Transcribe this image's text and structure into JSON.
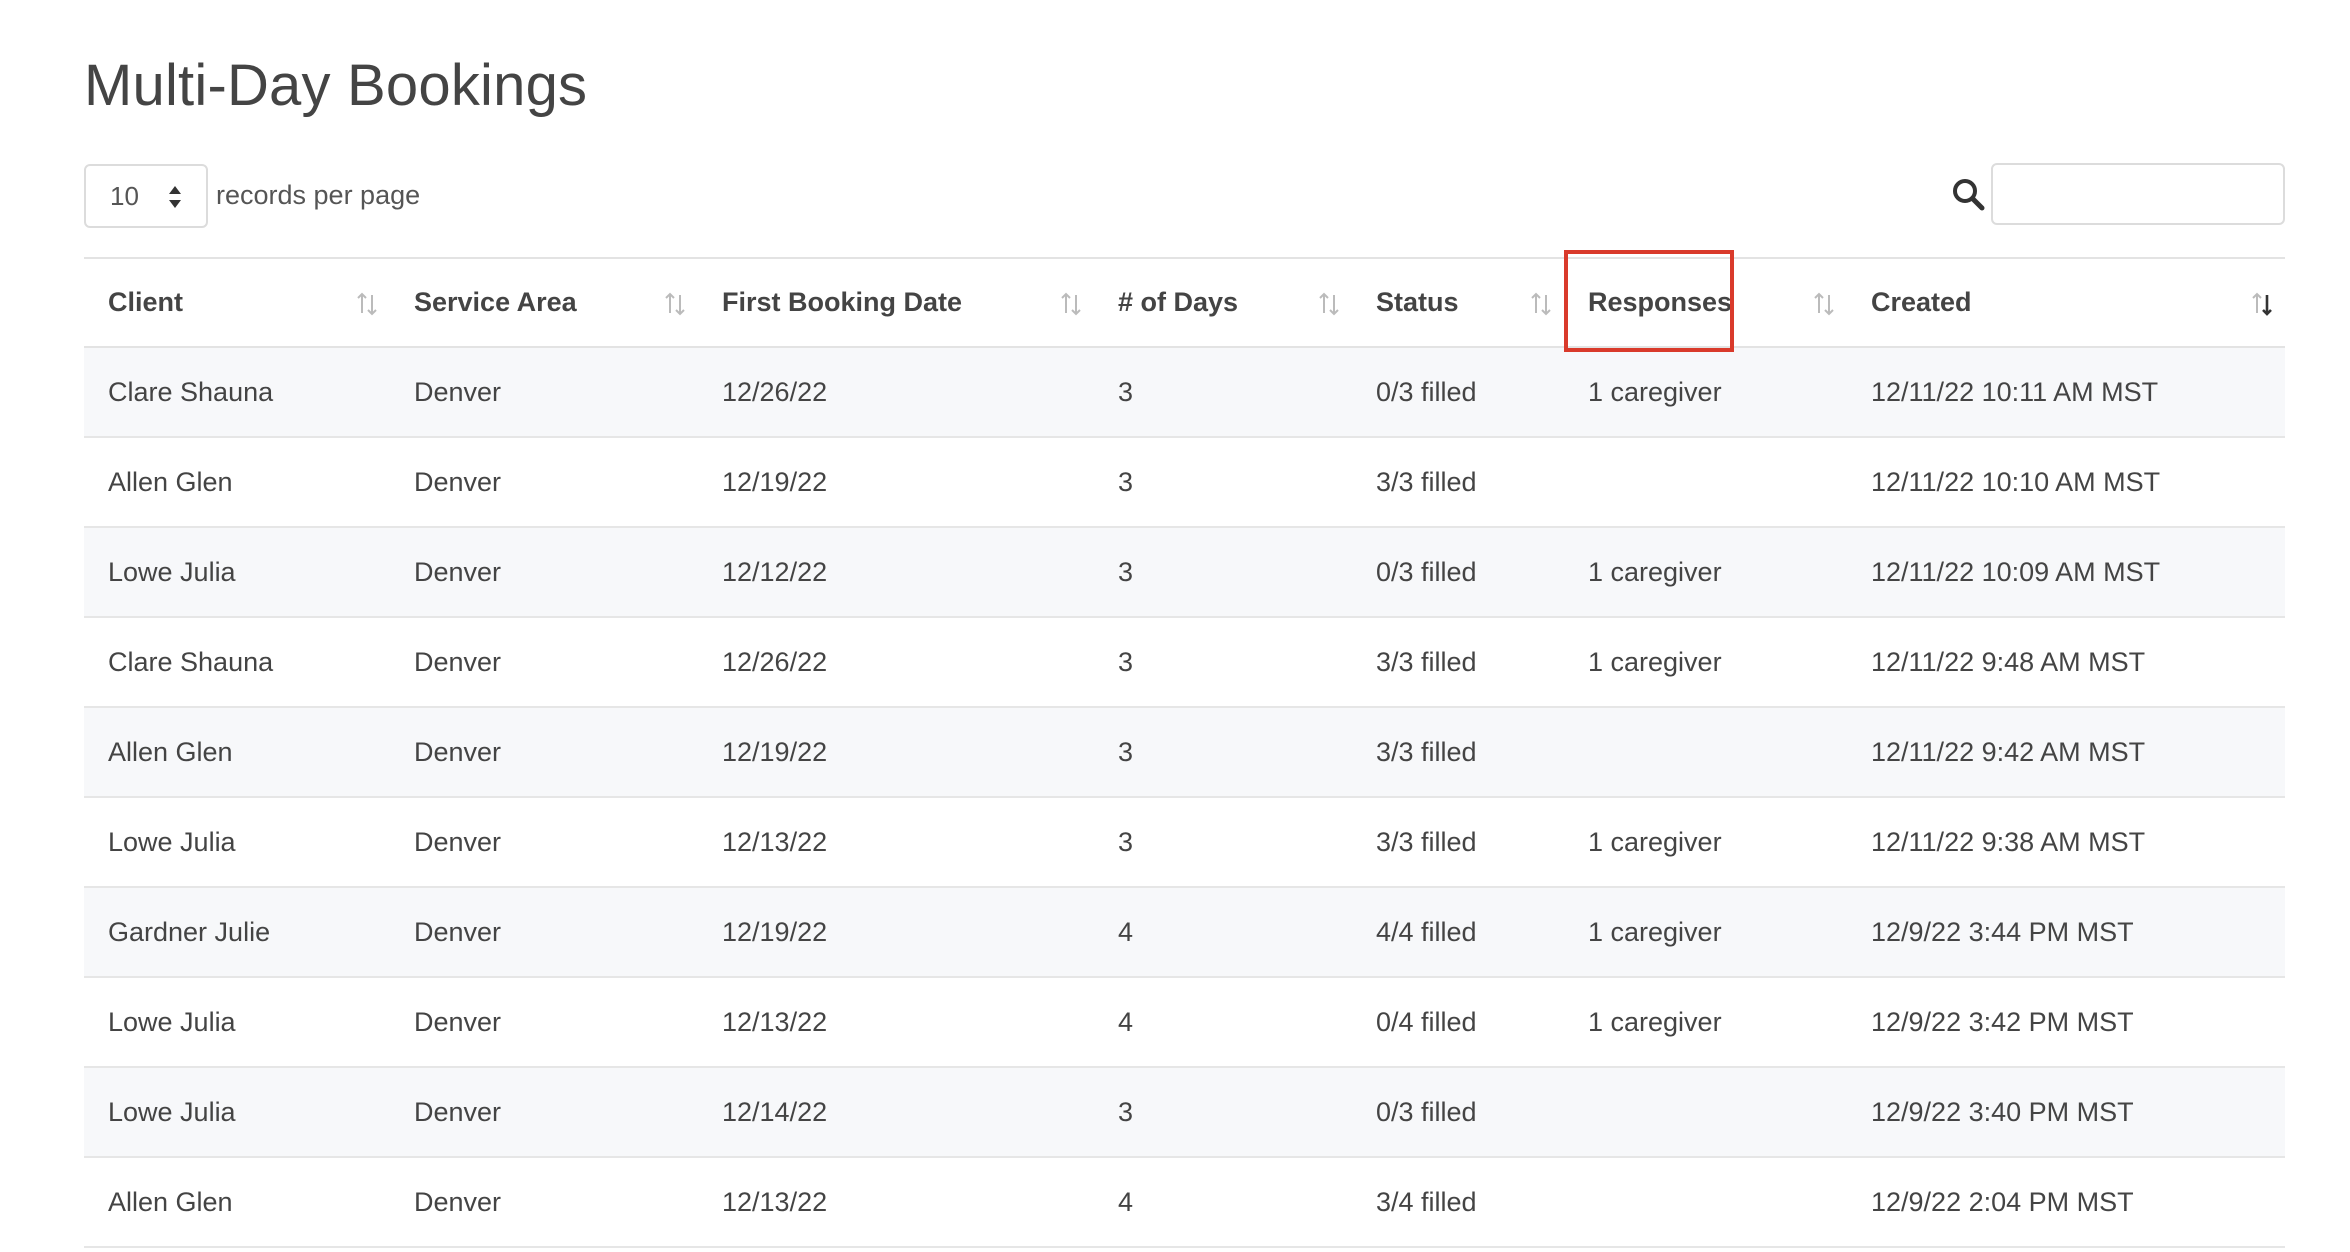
{
  "page": {
    "title": "Multi-Day Bookings"
  },
  "controls": {
    "records_per_page_value": "10",
    "records_per_page_label": "records per page",
    "search_value": "",
    "search_placeholder": ""
  },
  "table": {
    "columns": [
      {
        "label": "Client",
        "sort": "none"
      },
      {
        "label": "Service Area",
        "sort": "none"
      },
      {
        "label": "First Booking Date",
        "sort": "none"
      },
      {
        "label": "# of Days",
        "sort": "none"
      },
      {
        "label": "Status",
        "sort": "none"
      },
      {
        "label": "Responses",
        "sort": "none"
      },
      {
        "label": "Created",
        "sort": "descending"
      }
    ],
    "rows": [
      [
        "Clare Shauna",
        "Denver",
        "12/26/22",
        "3",
        "0/3 filled",
        "1 caregiver",
        "12/11/22 10:11 AM MST"
      ],
      [
        "Allen Glen",
        "Denver",
        "12/19/22",
        "3",
        "3/3 filled",
        "",
        "12/11/22 10:10 AM MST"
      ],
      [
        "Lowe Julia",
        "Denver",
        "12/12/22",
        "3",
        "0/3 filled",
        "1 caregiver",
        "12/11/22 10:09 AM MST"
      ],
      [
        "Clare Shauna",
        "Denver",
        "12/26/22",
        "3",
        "3/3 filled",
        "1 caregiver",
        "12/11/22 9:48 AM MST"
      ],
      [
        "Allen Glen",
        "Denver",
        "12/19/22",
        "3",
        "3/3 filled",
        "",
        "12/11/22 9:42 AM MST"
      ],
      [
        "Lowe Julia",
        "Denver",
        "12/13/22",
        "3",
        "3/3 filled",
        "1 caregiver",
        "12/11/22 9:38 AM MST"
      ],
      [
        "Gardner Julie",
        "Denver",
        "12/19/22",
        "4",
        "4/4 filled",
        "1 caregiver",
        "12/9/22 3:44 PM MST"
      ],
      [
        "Lowe Julia",
        "Denver",
        "12/13/22",
        "4",
        "0/4 filled",
        "1 caregiver",
        "12/9/22 3:42 PM MST"
      ],
      [
        "Lowe Julia",
        "Denver",
        "12/14/22",
        "3",
        "0/3 filled",
        "",
        "12/9/22 3:40 PM MST"
      ],
      [
        "Allen Glen",
        "Denver",
        "12/13/22",
        "4",
        "3/4 filled",
        "",
        "12/9/22 2:04 PM MST"
      ]
    ]
  },
  "annotation": {
    "highlighted_column": "Responses",
    "color": "#d93a2b"
  },
  "icons": {
    "search": "search-icon",
    "sort": "sort-icon",
    "select": "select-arrows-icon"
  },
  "colors": {
    "text": "#444444",
    "border": "#dcdcdc",
    "row_stripe": "#f7f8fa"
  }
}
